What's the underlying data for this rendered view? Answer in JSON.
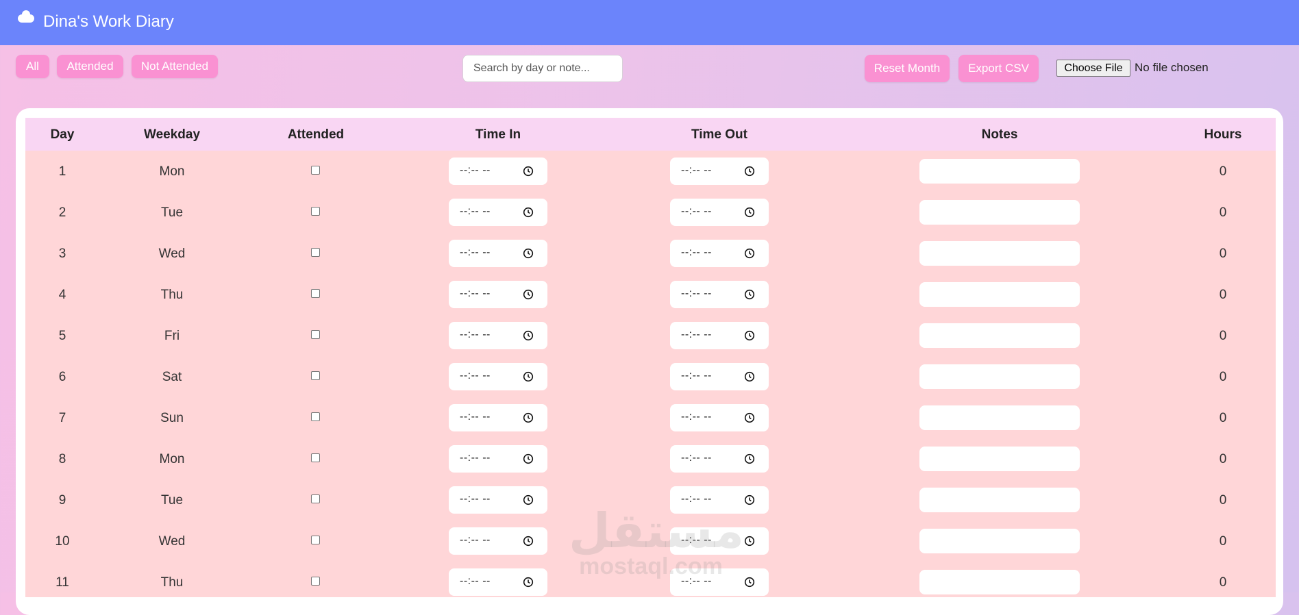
{
  "app": {
    "title": "Dina's Work Diary",
    "logo_icon": "cloud-icon"
  },
  "filters": {
    "all": "All",
    "attended": "Attended",
    "not_attended": "Not Attended"
  },
  "search": {
    "placeholder": "Search by day or note..."
  },
  "actions": {
    "reset": "Reset Month",
    "export": "Export CSV"
  },
  "file": {
    "button": "Choose File",
    "status": "No file chosen"
  },
  "table": {
    "headers": {
      "day": "Day",
      "weekday": "Weekday",
      "attended": "Attended",
      "time_in": "Time In",
      "time_out": "Time Out",
      "notes": "Notes",
      "hours": "Hours"
    },
    "time_placeholder": "--:-- --",
    "rows": [
      {
        "day": "1",
        "weekday": "Mon",
        "attended": false,
        "hours": "0"
      },
      {
        "day": "2",
        "weekday": "Tue",
        "attended": false,
        "hours": "0"
      },
      {
        "day": "3",
        "weekday": "Wed",
        "attended": false,
        "hours": "0"
      },
      {
        "day": "4",
        "weekday": "Thu",
        "attended": false,
        "hours": "0"
      },
      {
        "day": "5",
        "weekday": "Fri",
        "attended": false,
        "hours": "0"
      },
      {
        "day": "6",
        "weekday": "Sat",
        "attended": false,
        "hours": "0"
      },
      {
        "day": "7",
        "weekday": "Sun",
        "attended": false,
        "hours": "0"
      },
      {
        "day": "8",
        "weekday": "Mon",
        "attended": false,
        "hours": "0"
      },
      {
        "day": "9",
        "weekday": "Tue",
        "attended": false,
        "hours": "0"
      },
      {
        "day": "10",
        "weekday": "Wed",
        "attended": false,
        "hours": "0"
      },
      {
        "day": "11",
        "weekday": "Thu",
        "attended": false,
        "hours": "0"
      }
    ]
  },
  "watermark": {
    "arabic": "مستقل",
    "latin": "mostaql.com"
  },
  "colors": {
    "header": "#6b84fb",
    "pill": "#fa91d2",
    "table_header": "#f9d6f3",
    "row": "#ffd6d8"
  }
}
